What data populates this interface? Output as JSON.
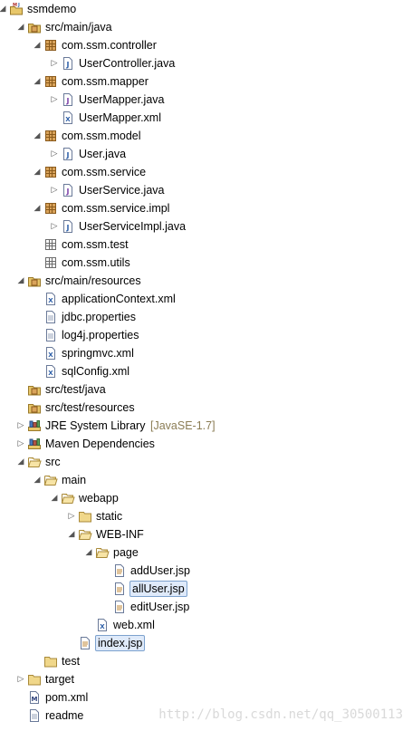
{
  "tree": [
    {
      "label": "ssmdemo",
      "icon": "maven-project-icon",
      "level": 0,
      "toggle": "expanded",
      "name": "project-ssmdemo"
    },
    {
      "label": "src/main/java",
      "icon": "source-folder-icon",
      "level": 1,
      "toggle": "expanded",
      "name": "folder-src-main-java"
    },
    {
      "label": "com.ssm.controller",
      "icon": "package-icon",
      "level": 2,
      "toggle": "expanded",
      "name": "package-com-ssm-controller"
    },
    {
      "label": "UserController.java",
      "icon": "java-file-icon",
      "level": 3,
      "toggle": "collapsed",
      "name": "file-usercontroller-java"
    },
    {
      "label": "com.ssm.mapper",
      "icon": "package-icon",
      "level": 2,
      "toggle": "expanded",
      "name": "package-com-ssm-mapper"
    },
    {
      "label": "UserMapper.java",
      "icon": "java-interface-icon",
      "level": 3,
      "toggle": "collapsed",
      "name": "file-usermapper-java"
    },
    {
      "label": "UserMapper.xml",
      "icon": "xml-file-icon",
      "level": 3,
      "toggle": "none",
      "name": "file-usermapper-xml"
    },
    {
      "label": "com.ssm.model",
      "icon": "package-icon",
      "level": 2,
      "toggle": "expanded",
      "name": "package-com-ssm-model"
    },
    {
      "label": "User.java",
      "icon": "java-file-icon",
      "level": 3,
      "toggle": "collapsed",
      "name": "file-user-java"
    },
    {
      "label": "com.ssm.service",
      "icon": "package-icon",
      "level": 2,
      "toggle": "expanded",
      "name": "package-com-ssm-service"
    },
    {
      "label": "UserService.java",
      "icon": "java-interface-icon",
      "level": 3,
      "toggle": "collapsed",
      "name": "file-userservice-java"
    },
    {
      "label": "com.ssm.service.impl",
      "icon": "package-icon",
      "level": 2,
      "toggle": "expanded",
      "name": "package-com-ssm-service-impl"
    },
    {
      "label": "UserServiceImpl.java",
      "icon": "java-file-icon",
      "level": 3,
      "toggle": "collapsed",
      "name": "file-userserviceimpl-java"
    },
    {
      "label": "com.ssm.test",
      "icon": "empty-package-icon",
      "level": 2,
      "toggle": "none",
      "name": "package-com-ssm-test"
    },
    {
      "label": "com.ssm.utils",
      "icon": "empty-package-icon",
      "level": 2,
      "toggle": "none",
      "name": "package-com-ssm-utils"
    },
    {
      "label": "src/main/resources",
      "icon": "source-folder-icon",
      "level": 1,
      "toggle": "expanded",
      "name": "folder-src-main-resources"
    },
    {
      "label": "applicationContext.xml",
      "icon": "xml-file-icon",
      "level": 2,
      "toggle": "none",
      "name": "file-applicationcontext-xml"
    },
    {
      "label": "jdbc.properties",
      "icon": "text-file-icon",
      "level": 2,
      "toggle": "none",
      "name": "file-jdbc-properties"
    },
    {
      "label": "log4j.properties",
      "icon": "text-file-icon",
      "level": 2,
      "toggle": "none",
      "name": "file-log4j-properties"
    },
    {
      "label": "springmvc.xml",
      "icon": "xml-file-icon",
      "level": 2,
      "toggle": "none",
      "name": "file-springmvc-xml"
    },
    {
      "label": "sqlConfig.xml",
      "icon": "xml-file-icon",
      "level": 2,
      "toggle": "none",
      "name": "file-sqlconfig-xml"
    },
    {
      "label": "src/test/java",
      "icon": "source-folder-icon",
      "level": 1,
      "toggle": "none",
      "name": "folder-src-test-java"
    },
    {
      "label": "src/test/resources",
      "icon": "source-folder-icon",
      "level": 1,
      "toggle": "none",
      "name": "folder-src-test-resources"
    },
    {
      "label": "JRE System Library",
      "decoration": "[JavaSE-1.7]",
      "icon": "library-icon",
      "level": 1,
      "toggle": "collapsed",
      "name": "library-jre-system"
    },
    {
      "label": "Maven Dependencies",
      "icon": "library-icon",
      "level": 1,
      "toggle": "collapsed",
      "name": "library-maven-dependencies"
    },
    {
      "label": "src",
      "icon": "folder-open-icon",
      "level": 1,
      "toggle": "expanded",
      "name": "folder-src"
    },
    {
      "label": "main",
      "icon": "folder-open-icon",
      "level": 2,
      "toggle": "expanded",
      "name": "folder-main"
    },
    {
      "label": "webapp",
      "icon": "folder-open-icon",
      "level": 3,
      "toggle": "expanded",
      "name": "folder-webapp"
    },
    {
      "label": "static",
      "icon": "folder-icon",
      "level": 4,
      "toggle": "collapsed",
      "name": "folder-static"
    },
    {
      "label": "WEB-INF",
      "icon": "folder-open-icon",
      "level": 4,
      "toggle": "expanded",
      "name": "folder-web-inf"
    },
    {
      "label": "page",
      "icon": "folder-open-icon",
      "level": 5,
      "toggle": "expanded",
      "name": "folder-page"
    },
    {
      "label": "addUser.jsp",
      "icon": "jsp-file-icon",
      "level": 6,
      "toggle": "none",
      "name": "file-adduser-jsp"
    },
    {
      "label": "allUser.jsp",
      "icon": "jsp-file-icon",
      "level": 6,
      "toggle": "none",
      "name": "file-alluser-jsp",
      "selected": true
    },
    {
      "label": "editUser.jsp",
      "icon": "jsp-file-icon",
      "level": 6,
      "toggle": "none",
      "name": "file-edituser-jsp"
    },
    {
      "label": "web.xml",
      "icon": "xml-file-icon",
      "level": 5,
      "toggle": "none",
      "name": "file-web-xml"
    },
    {
      "label": "index.jsp",
      "icon": "jsp-file-icon",
      "level": 4,
      "toggle": "none",
      "name": "file-index-jsp",
      "selected": true
    },
    {
      "label": "test",
      "icon": "folder-icon",
      "level": 2,
      "toggle": "none",
      "name": "folder-test"
    },
    {
      "label": "target",
      "icon": "folder-icon",
      "level": 1,
      "toggle": "collapsed",
      "name": "folder-target"
    },
    {
      "label": "pom.xml",
      "icon": "maven-pom-icon",
      "level": 1,
      "toggle": "none",
      "name": "file-pom-xml"
    },
    {
      "label": "readme",
      "icon": "text-file-icon",
      "level": 1,
      "toggle": "none",
      "name": "file-readme"
    }
  ],
  "toggles": {
    "expanded": "◢",
    "collapsed": "▷"
  },
  "watermark": "http://blog.csdn.net/qq_30500113",
  "colors": {
    "selection_border": "#7da2ce",
    "selection_fill": "#dfeafa",
    "decoration_text": "#8b7d55"
  }
}
